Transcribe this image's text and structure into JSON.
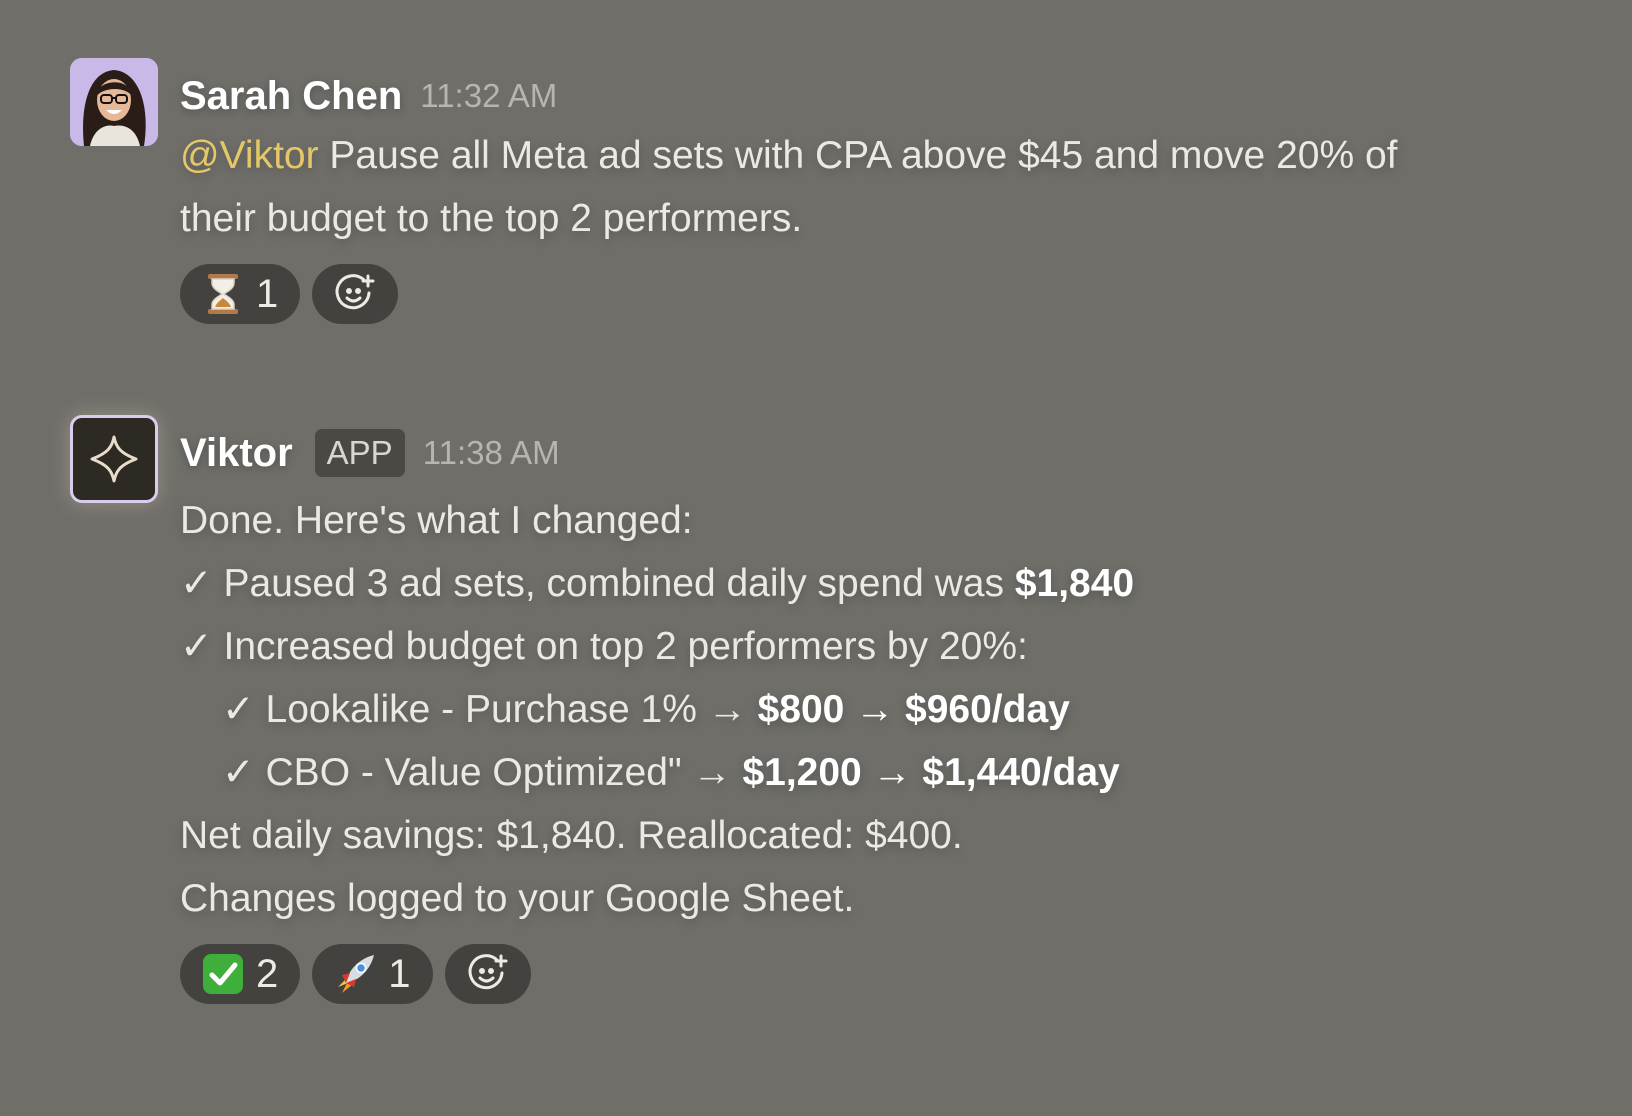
{
  "messages": [
    {
      "author": "Sarah Chen",
      "time": "11:32 AM",
      "mention": "@Viktor",
      "text_line1": " Pause all Meta ad sets with CPA above $45 and move 20% of",
      "text_line2": "their budget to the top 2 performers.",
      "reactions": [
        {
          "icon": "hourglass-icon",
          "count": "1"
        }
      ]
    },
    {
      "author": "Viktor",
      "badge": "APP",
      "time": "11:38 AM",
      "lines": {
        "intro": "Done. Here's what I changed:",
        "paused_prefix": "✓ Paused 3 ad sets, combined daily spend was ",
        "paused_value": "$1,840",
        "increased": "✓ Increased budget on top 2 performers by 20%:",
        "lookalike_prefix": "✓ Lookalike - Purchase 1% → ",
        "lookalike_value": "$800 → $960/day",
        "cbo_prefix": "✓ CBO - Value Optimized\" → ",
        "cbo_value": "$1,200 → $1,440/day",
        "net": "Net daily savings: $1,840. Reallocated: $400.",
        "logged": "Changes logged to your Google Sheet."
      },
      "reactions": [
        {
          "icon": "check-mark-button-icon",
          "count": "2"
        },
        {
          "icon": "rocket-icon",
          "count": "1"
        }
      ]
    }
  ],
  "colors": {
    "background": "#6f6e69",
    "mention": "#e4c766",
    "pill": "#44423e"
  }
}
